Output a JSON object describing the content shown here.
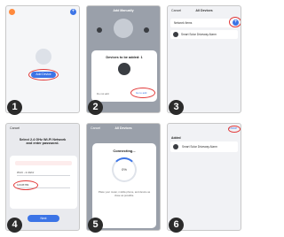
{
  "steps": [
    "1",
    "2",
    "3",
    "4",
    "5",
    "6"
  ],
  "screen1": {
    "button": "Add Device"
  },
  "screen2": {
    "title": "Add Manually",
    "dialog_title": "Devices to be added: 1",
    "skip": "Do not add",
    "confirm": "Go to add"
  },
  "screen3": {
    "cancel": "Cancel",
    "title": "All Devices",
    "row1": "Network Items",
    "row2": "Smart Solar Driveway Alarm"
  },
  "screen4": {
    "cancel": "Cancel",
    "heading_line1": "Select 2.4 GHz Wi-Fi Network",
    "heading_line2": "and enter password.",
    "wifi_name": "Wi-Fi - 2.4Ghz",
    "password": "12345789",
    "next": "Next"
  },
  "screen5": {
    "cancel": "Cancel",
    "title": "All Devices",
    "dialog_title": "Connecting...",
    "percent": "0%",
    "tip": "Place your router, mobile phone, and device as close as possible."
  },
  "screen6": {
    "done": "Done",
    "added_label": "Added",
    "device": "Smart Solar Driveway Alarm"
  },
  "colors": {
    "accent": "#3c74e6",
    "highlight": "#e23a3a"
  }
}
